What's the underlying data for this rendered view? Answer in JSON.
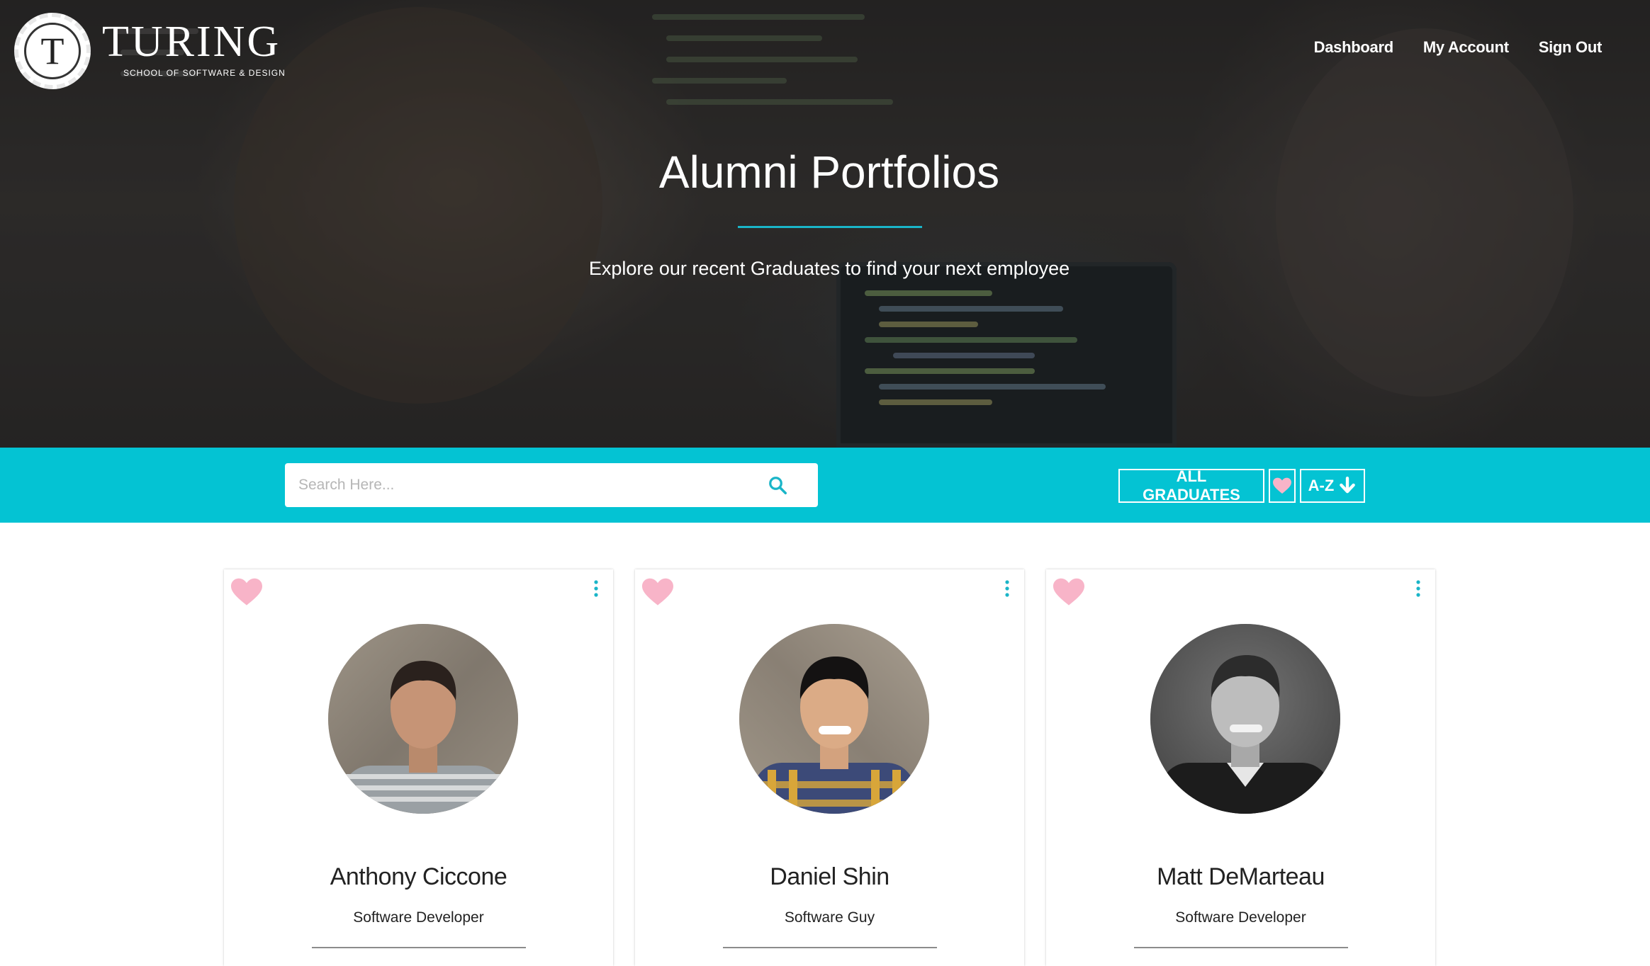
{
  "brand": {
    "seal_letter": "T",
    "name": "TURING",
    "tagline": "SCHOOL OF SOFTWARE & DESIGN"
  },
  "nav": {
    "links": [
      {
        "label": "Dashboard"
      },
      {
        "label": "My Account"
      },
      {
        "label": "Sign Out"
      }
    ]
  },
  "hero": {
    "title": "Alumni Portfolios",
    "subtitle": "Explore our recent Graduates to find your next employee"
  },
  "toolbar": {
    "search_placeholder": "Search Here...",
    "search_icon": "search-icon",
    "filter_all_label": "ALL GRADUATES",
    "favorites_icon": "heart-icon",
    "sort_label": "A-Z",
    "sort_icon": "arrow-down-icon"
  },
  "cards": [
    {
      "name": "Anthony Ciccone",
      "role": "Software Developer"
    },
    {
      "name": "Daniel Shin",
      "role": "Software Guy"
    },
    {
      "name": "Matt DeMarteau",
      "role": "Software Developer"
    }
  ],
  "colors": {
    "accent": "#04c3d3",
    "hero_rule": "#1ab5c8",
    "favorite_heart": "#f8b4c8",
    "card_menu": "#1ab5c8"
  }
}
